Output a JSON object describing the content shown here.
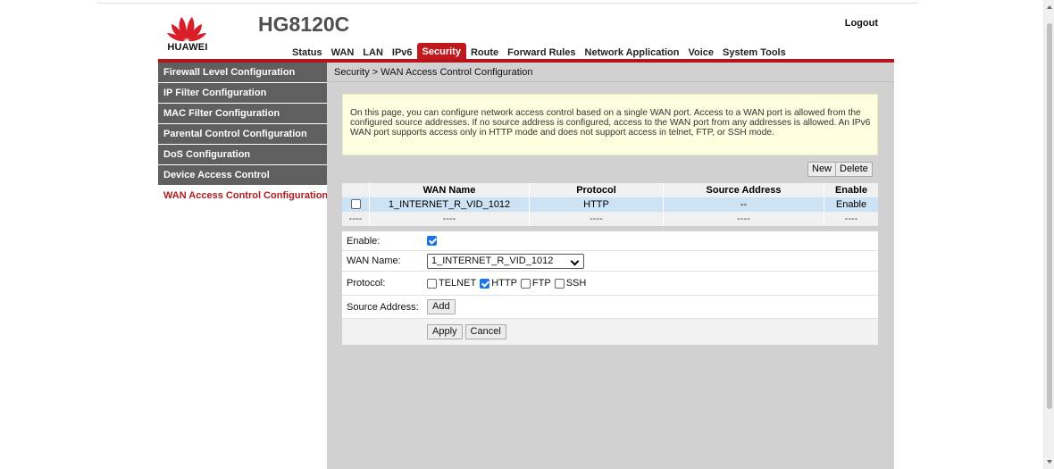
{
  "brand": {
    "logo_text": "HUAWEI",
    "model": "HG8120C",
    "logout": "Logout",
    "accent": "#c0191e"
  },
  "nav": {
    "items": [
      "Status",
      "WAN",
      "LAN",
      "IPv6",
      "Security",
      "Route",
      "Forward Rules",
      "Network Application",
      "Voice",
      "System Tools"
    ],
    "active": "Security"
  },
  "sidebar": {
    "items": [
      "Firewall Level Configuration",
      "IP Filter Configuration",
      "MAC Filter Configuration",
      "Parental Control Configuration",
      "DoS Configuration",
      "Device Access Control",
      "WAN Access Control Configuration"
    ],
    "active": "WAN Access Control Configuration"
  },
  "breadcrumb": "Security > WAN Access Control Configuration",
  "info": "On this page, you can configure network access control based on a single WAN port. Access to a WAN port is allowed from the configured source addresses. If no source address is configured, access to the WAN port from any addresses is allowed. An IPv6 WAN port supports access only in HTTP mode and does not support access in telnet, FTP, or SSH mode.",
  "buttons": {
    "new": "New",
    "delete": "Delete"
  },
  "table": {
    "headers": [
      "",
      "WAN Name",
      "Protocol",
      "Source Address",
      "Enable"
    ],
    "rows": [
      {
        "checked": false,
        "wan_name": "1_INTERNET_R_VID_1012",
        "protocol": "HTTP",
        "source": "--",
        "enable": "Enable"
      }
    ],
    "dash_row": [
      "----",
      "----",
      "----",
      "----",
      "----"
    ]
  },
  "form": {
    "enable_label": "Enable:",
    "enable_checked": true,
    "wan_label": "WAN Name:",
    "wan_value": "1_INTERNET_R_VID_1012",
    "protocol_label": "Protocol:",
    "protocols": [
      {
        "name": "TELNET",
        "checked": false
      },
      {
        "name": "HTTP",
        "checked": true
      },
      {
        "name": "FTP",
        "checked": false
      },
      {
        "name": "SSH",
        "checked": false
      }
    ],
    "source_label": "Source Address:",
    "add": "Add",
    "apply": "Apply",
    "cancel": "Cancel"
  }
}
